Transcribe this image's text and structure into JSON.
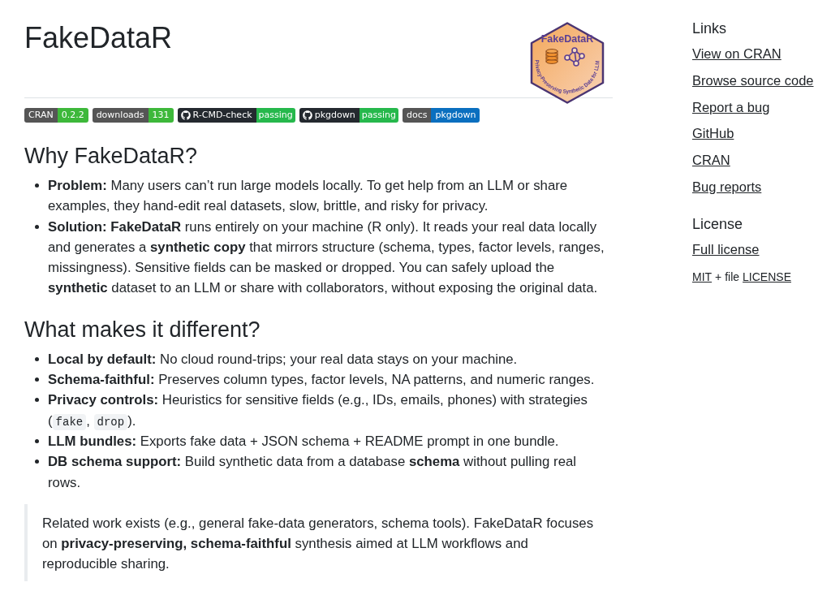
{
  "header": {
    "title": "FakeDataR"
  },
  "logo": {
    "title": "FakeDataR",
    "tagline": "Privacy-Preserving Synthetic Data for LLM"
  },
  "badges": [
    {
      "kind": "plain",
      "label": "CRAN",
      "value": "0.2.2",
      "color": "#3db83a"
    },
    {
      "kind": "plain",
      "label": "downloads",
      "value": "131",
      "color": "#3db83a"
    },
    {
      "kind": "github",
      "label": "R-CMD-check",
      "value": "passing",
      "color": "#26b84c"
    },
    {
      "kind": "github",
      "label": "pkgdown",
      "value": "passing",
      "color": "#26b84c"
    },
    {
      "kind": "plain",
      "label": "docs",
      "value": "pkgdown",
      "color": "#0a6fbf"
    }
  ],
  "sections": [
    {
      "heading": "Why FakeDataR?",
      "items": [
        {
          "parts": [
            {
              "kind": "rich",
              "text": "**Problem:** Many users can’t run large models locally. To get help from an LLM or share examples, they hand-edit real datasets, slow, brittle, and risky for privacy."
            }
          ]
        },
        {
          "parts": [
            {
              "kind": "rich",
              "text": "**Solution: FakeDataR** runs entirely on your machine (R only). It reads your real data locally and generates a **synthetic copy** that mirrors structure (schema, types, factor levels, ranges, missingness). Sensitive fields can be masked or dropped. You can safely upload the **synthetic** dataset to an LLM or share with collaborators, without exposing the original data."
            }
          ]
        }
      ]
    },
    {
      "heading": "What makes it different?",
      "items": [
        {
          "parts": [
            {
              "kind": "rich",
              "text": "**Local by default:** No cloud round-trips; your real data stays on your machine."
            }
          ]
        },
        {
          "parts": [
            {
              "kind": "rich",
              "text": "**Schema-faithful:** Preserves column types, factor levels, NA patterns, and numeric ranges."
            }
          ]
        },
        {
          "parts": [
            {
              "kind": "rich",
              "text": "**Privacy controls:** Heuristics for sensitive fields (e.g., IDs, emails, phones) with strategies ("
            },
            {
              "kind": "code",
              "text": "fake"
            },
            {
              "kind": "rich",
              "text": ", "
            },
            {
              "kind": "code",
              "text": "drop"
            },
            {
              "kind": "rich",
              "text": ")."
            }
          ]
        },
        {
          "parts": [
            {
              "kind": "rich",
              "text": "**LLM bundles:** Exports fake data + JSON schema + README prompt in one bundle."
            }
          ]
        },
        {
          "parts": [
            {
              "kind": "rich",
              "text": "**DB schema support:** Build synthetic data from a database **schema** without pulling real rows."
            }
          ]
        }
      ]
    }
  ],
  "quote": {
    "text": "Related work exists (e.g., general fake-data generators, schema tools). FakeDataR focuses on **privacy-preserving, schema-faithful** synthesis aimed at LLM workflows and reproducible sharing."
  },
  "sidebar": {
    "links_heading": "Links",
    "links": [
      "View on CRAN",
      "Browse source code",
      "Report a bug",
      "GitHub",
      "CRAN",
      "Bug reports"
    ],
    "license_heading": "License",
    "license_links": [
      "Full license"
    ],
    "license_line": [
      {
        "kind": "link",
        "text": "MIT"
      },
      {
        "kind": "text",
        "text": "+ file"
      },
      {
        "kind": "link",
        "text": "LICENSE"
      }
    ]
  }
}
